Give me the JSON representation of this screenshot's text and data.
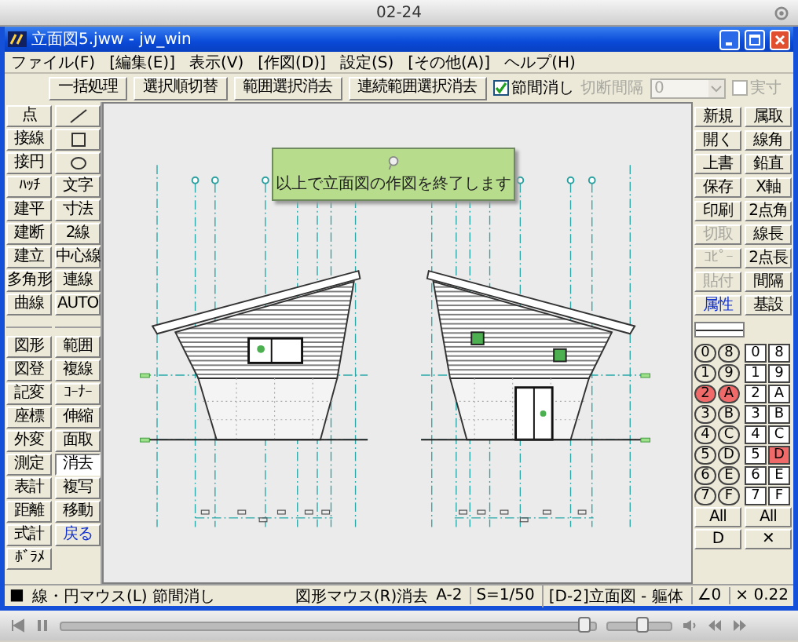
{
  "player": {
    "title": "02-24",
    "progress": {
      "level": 0.98
    },
    "volume": {
      "level": 0.55
    }
  },
  "window": {
    "title": "立面図5.jww - jw_win"
  },
  "menu": [
    "ファイル(F)",
    "[編集(E)]",
    "表示(V)",
    "[作図(D)]",
    "設定(S)",
    "[その他(A)]",
    "ヘルプ(H)"
  ],
  "toolbar": {
    "buttons": [
      "一括処理",
      "選択順切替",
      "範囲選択消去",
      "連続範囲選択消去"
    ],
    "option": {
      "label": "節間消し",
      "checked": true
    },
    "interval": {
      "label": "切断間隔",
      "value": "0",
      "disabled": true
    },
    "actual_size": {
      "label": "実寸",
      "checked": false,
      "disabled": true
    }
  },
  "left_palette": {
    "columns": [
      {
        "upper": [
          {
            "label": "点",
            "selected": false
          },
          {
            "label": "接線",
            "selected": false
          },
          {
            "label": "接円",
            "selected": false
          },
          {
            "label": "ﾊｯﾁ",
            "selected": false
          },
          {
            "label": "建平",
            "selected": false
          },
          {
            "label": "建断",
            "selected": false
          },
          {
            "label": "建立",
            "selected": false
          },
          {
            "label": "多角形",
            "selected": false
          },
          {
            "label": "曲線",
            "selected": false
          }
        ],
        "lower": [
          {
            "label": "図形",
            "selected": false
          },
          {
            "label": "図登",
            "selected": false
          },
          {
            "label": "記変",
            "selected": false
          },
          {
            "label": "座標",
            "selected": false
          },
          {
            "label": "外変",
            "selected": false
          },
          {
            "label": "測定",
            "selected": false
          },
          {
            "label": "表計",
            "selected": false
          },
          {
            "label": "距離",
            "selected": false
          },
          {
            "label": "式計",
            "selected": false
          },
          {
            "label": "ﾎﾞﾗﾒ",
            "selected": false
          }
        ]
      },
      {
        "upper": [
          {
            "kind": "line",
            "selected": false
          },
          {
            "kind": "rect",
            "selected": false
          },
          {
            "kind": "circle",
            "selected": false
          },
          {
            "kind": "text",
            "label": "文字",
            "selected": false
          },
          {
            "kind": "text",
            "label": "寸法",
            "selected": false
          },
          {
            "kind": "text",
            "label": "2線",
            "selected": false
          },
          {
            "kind": "text",
            "label": "中心線",
            "selected": false
          },
          {
            "kind": "text",
            "label": "連線",
            "selected": false
          },
          {
            "kind": "text",
            "label": "AUTO",
            "selected": false
          }
        ],
        "lower": [
          {
            "kind": "text",
            "label": "範囲",
            "selected": false
          },
          {
            "kind": "text",
            "label": "複線",
            "selected": false
          },
          {
            "kind": "text",
            "label": "ｺｰﾅｰ",
            "selected": false
          },
          {
            "kind": "text",
            "label": "伸縮",
            "selected": false
          },
          {
            "kind": "text",
            "label": "面取",
            "selected": false
          },
          {
            "kind": "text",
            "label": "消去",
            "selected": true
          },
          {
            "kind": "text",
            "label": "複写",
            "selected": false
          },
          {
            "kind": "text",
            "label": "移動",
            "selected": false
          },
          {
            "kind": "accent",
            "label": "戻る",
            "selected": false
          }
        ]
      }
    ]
  },
  "canvas": {
    "tooltip": "以上で立面図の作図を終了します"
  },
  "right_palette": {
    "column_1": [
      {
        "label": "新規",
        "kind": "normal",
        "disabled": false
      },
      {
        "label": "開く",
        "kind": "normal",
        "disabled": false
      },
      {
        "label": "上書",
        "kind": "normal",
        "disabled": false
      },
      {
        "label": "保存",
        "kind": "normal",
        "disabled": false
      },
      {
        "label": "印刷",
        "kind": "normal",
        "disabled": false
      },
      {
        "label": "切取",
        "kind": "normal",
        "disabled": true
      },
      {
        "label": "ｺﾋﾟｰ",
        "kind": "normal",
        "disabled": true
      },
      {
        "label": "貼付",
        "kind": "normal",
        "disabled": true
      },
      {
        "label": "属性",
        "kind": "accent",
        "disabled": false
      }
    ],
    "column_2": [
      "属取",
      "線角",
      "鉛直",
      "X軸",
      "2点角",
      "線長",
      "2点長",
      "間隔",
      "基設"
    ],
    "layer_groups": [
      {
        "label": "0",
        "selected": false
      },
      {
        "label": "1",
        "selected": false
      },
      {
        "label": "2",
        "selected": true
      },
      {
        "label": "3",
        "selected": false
      },
      {
        "label": "4",
        "selected": false
      },
      {
        "label": "5",
        "selected": false
      },
      {
        "label": "6",
        "selected": false
      },
      {
        "label": "7",
        "selected": false
      },
      {
        "label": "8",
        "selected": false
      },
      {
        "label": "9",
        "selected": false
      },
      {
        "label": "A",
        "selected": true
      },
      {
        "label": "B",
        "selected": false
      },
      {
        "label": "C",
        "selected": false
      },
      {
        "label": "D",
        "selected": false
      },
      {
        "label": "E",
        "selected": false
      },
      {
        "label": "F",
        "selected": false
      }
    ],
    "layer_groups_all": "All",
    "layer_groups_footer": "D",
    "layers": [
      {
        "label": "0",
        "selected": false
      },
      {
        "label": "1",
        "selected": false
      },
      {
        "label": "2",
        "selected": false
      },
      {
        "label": "3",
        "selected": false
      },
      {
        "label": "4",
        "selected": false
      },
      {
        "label": "5",
        "selected": false
      },
      {
        "label": "6",
        "selected": false
      },
      {
        "label": "7",
        "selected": false
      },
      {
        "label": "8",
        "selected": false
      },
      {
        "label": "9",
        "selected": false
      },
      {
        "label": "A",
        "selected": false
      },
      {
        "label": "B",
        "selected": false
      },
      {
        "label": "C",
        "selected": false
      },
      {
        "label": "D",
        "selected": true
      },
      {
        "label": "E",
        "selected": false
      },
      {
        "label": "F",
        "selected": false
      }
    ],
    "layers_all": "All",
    "layers_close": "✕"
  },
  "status_bar": [
    "■",
    "線・円マウス(L) 節間消し",
    "図形マウス(R)消去",
    "A-2",
    "S=1/50",
    "[D-2]立面図 - 軀体",
    "∠0",
    "× 0.22"
  ]
}
